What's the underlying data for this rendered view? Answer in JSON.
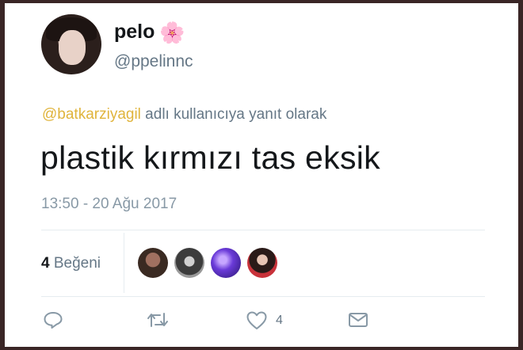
{
  "user": {
    "display_name": "pelo",
    "emoji": "🌸",
    "handle": "@ppelinnc"
  },
  "reply": {
    "mention": "@batkarziyagil",
    "suffix": " adlı kullanıcıya yanıt olarak"
  },
  "tweet": {
    "text": "plastik kırmızı tas eksik",
    "timestamp": "13:50 - 20 Ağu 2017"
  },
  "stats": {
    "likes_count": "4",
    "likes_label": " Beğeni"
  },
  "actions": {
    "like_count": "4"
  },
  "colors": {
    "mention": "#e0b43c",
    "secondary_text": "#657786",
    "primary_text": "#14171a"
  },
  "icons": [
    "reply-icon",
    "retweet-icon",
    "heart-icon",
    "message-icon"
  ]
}
